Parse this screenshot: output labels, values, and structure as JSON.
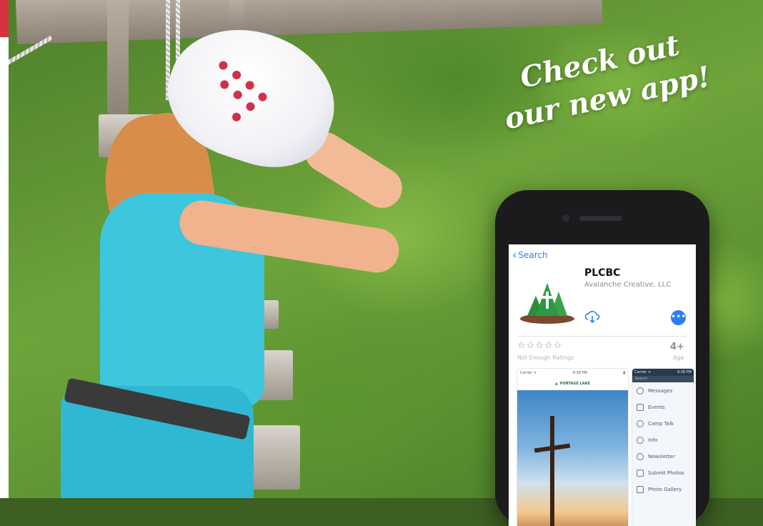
{
  "headline": {
    "line1": "Check out",
    "line2": "our new app!"
  },
  "app_store": {
    "back_label": "Search",
    "app_name": "PLCBC",
    "developer": "Avalanche Creative, LLC",
    "more_button": "•••",
    "stars": "☆☆☆☆☆",
    "ratings_label": "Not Enough Ratings",
    "age_rating": "4+",
    "age_label": "Age"
  },
  "screenshot_left": {
    "status_carrier": "Carrier ᯤ",
    "status_time": "9:38 PM",
    "header_logo_text": "PORTAGE LAKE"
  },
  "screenshot_right": {
    "status_carrier": "Carrier ᯤ",
    "status_time": "9:38 PM",
    "search_placeholder": "Search",
    "menu": [
      {
        "label": "Messages",
        "icon": "bell-icon"
      },
      {
        "label": "Events",
        "icon": "calendar-icon"
      },
      {
        "label": "Camp Talk",
        "icon": "chat-icon"
      },
      {
        "label": "Info",
        "icon": "info-icon"
      },
      {
        "label": "Newsletter",
        "icon": "newsletter-icon"
      },
      {
        "label": "Submit Photos",
        "icon": "camera-icon"
      },
      {
        "label": "Photo Gallery",
        "icon": "gallery-icon"
      }
    ]
  },
  "colors": {
    "accent_red": "#d4333f",
    "ios_blue": "#2f7df6",
    "foliage": "#5c962f",
    "shirt": "#3ec6dc"
  }
}
